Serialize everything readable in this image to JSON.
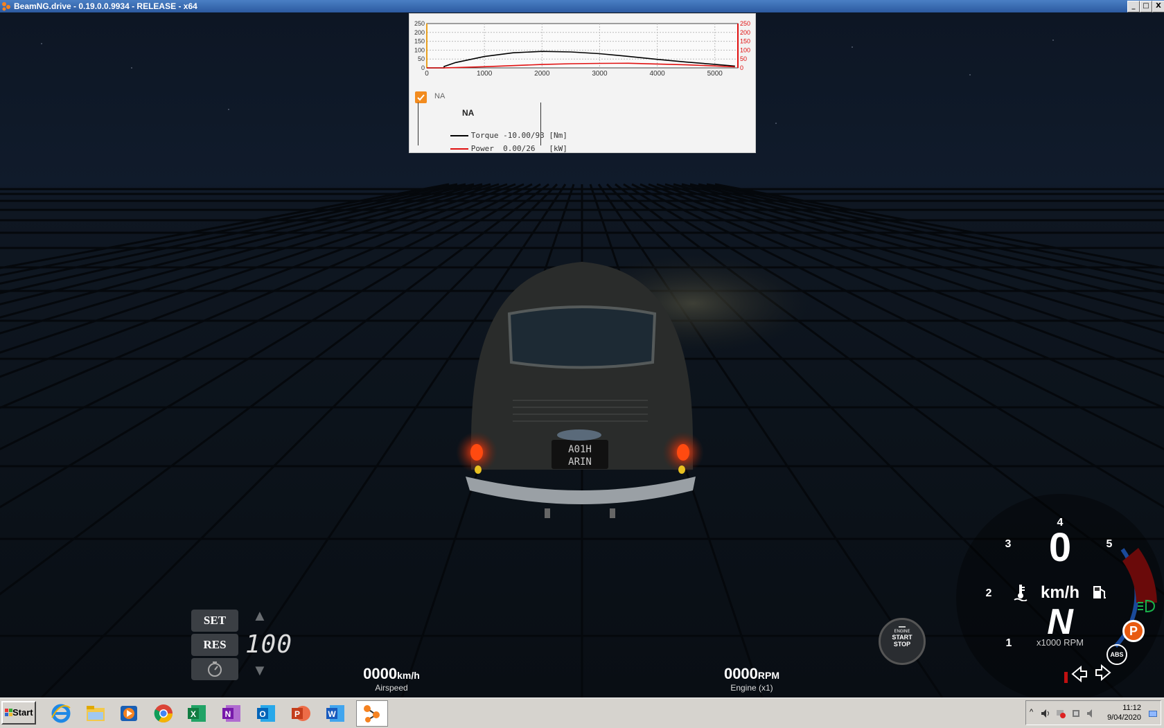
{
  "window": {
    "title": "BeamNG.drive - 0.19.0.0.9934 - RELEASE - x64",
    "minimize": "_",
    "maximize": "□",
    "close": "X"
  },
  "graph": {
    "y_left_ticks": [
      "250",
      "200",
      "150",
      "100",
      "50",
      "0"
    ],
    "y_right_ticks": [
      "250",
      "200",
      "150",
      "100",
      "50",
      "0"
    ],
    "x_ticks": [
      "0",
      "1000",
      "2000",
      "3000",
      "4000",
      "5000"
    ],
    "checkbox_label": "NA",
    "legend_title": "NA",
    "torque_label": "Torque -10.00/93 [Nm]",
    "power_label": "Power  0.00/26   [kW]",
    "colors": {
      "torque": "#000000",
      "power": "#e01010",
      "left_axis": "#e8a020",
      "right_axis": "#e01010"
    }
  },
  "chart_data": {
    "type": "line",
    "x": [
      0,
      300,
      301,
      500,
      1000,
      1500,
      2000,
      2500,
      3000,
      3500,
      4000,
      4500,
      5000,
      5350
    ],
    "series": [
      {
        "name": "Torque",
        "values": [
          -10,
          -10,
          8,
          30,
          64,
          85,
          93,
          90,
          80,
          65,
          48,
          33,
          20,
          10
        ]
      },
      {
        "name": "Power",
        "values": [
          0,
          0,
          0.3,
          1.5,
          6.5,
          13,
          19,
          23.5,
          25.5,
          26,
          22,
          17,
          11,
          6
        ]
      }
    ],
    "xlim": [
      0,
      5400
    ],
    "ylim": [
      0,
      250
    ],
    "grid": true
  },
  "cruise_control": {
    "set_label": "SET",
    "res_label": "RES",
    "speed_value": "100",
    "up_arrow": "▲",
    "down_arrow": "▼"
  },
  "airspeed": {
    "value": "0000",
    "unit": "km/h",
    "label": "Airspeed"
  },
  "engine_rpm": {
    "value": "0000",
    "unit": "RPM",
    "label": "Engine (x1)"
  },
  "engine_button": {
    "line1": "ENGINE",
    "line2": "START",
    "line3": "STOP"
  },
  "dashboard": {
    "speed": "0",
    "speed_unit": "km/h",
    "gear": "N",
    "rpm_label": "x1000 RPM",
    "rpm_ticks": [
      "1",
      "2",
      "3",
      "4",
      "5"
    ],
    "parking_label": "P",
    "abs_label": "ABS",
    "colors": {
      "parking": "#e85a10",
      "arc": "#1a4a9a",
      "redline": "#6a0a0a",
      "headlight": "#19b34a"
    }
  },
  "taskbar": {
    "start_label": "Start",
    "apps": [
      "internet-explorer-icon",
      "file-explorer-icon",
      "media-player-icon",
      "chrome-icon",
      "excel-icon",
      "onenote-icon",
      "outlook-icon",
      "powerpoint-icon",
      "word-icon",
      "beamng-icon"
    ],
    "time": "11:12",
    "date": "9/04/2020",
    "tray_expand": "^"
  }
}
